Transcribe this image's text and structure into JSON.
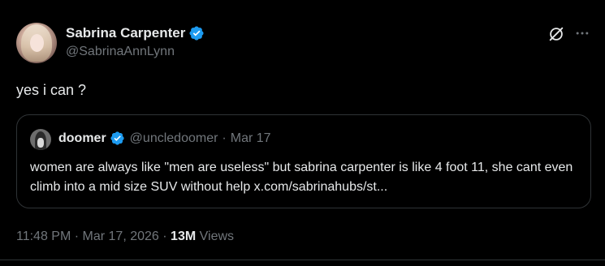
{
  "tweet": {
    "author_name": "Sabrina Carpenter",
    "author_handle": "@SabrinaAnnLynn",
    "text": "yes i can ?",
    "time": "11:48 PM",
    "date": "Mar 17, 2026",
    "separator": "·",
    "views_count": "13M",
    "views_label": "Views"
  },
  "quote": {
    "author_name": "doomer",
    "author_handle": "@uncledoomer",
    "separator": "·",
    "date": "Mar 17",
    "text": "women are always like \"men are useless\" but sabrina carpenter is like 4 foot 11, she cant even climb into a mid size SUV without help x.com/sabrinahubs/st..."
  },
  "colors": {
    "background": "#000000",
    "text": "#e7e9ea",
    "muted": "#71767b",
    "verified": "#1d9bf0",
    "border": "#2f3336"
  },
  "icons": {
    "verified": "verified-badge-icon",
    "grok": "grok-icon",
    "more": "more-icon"
  }
}
